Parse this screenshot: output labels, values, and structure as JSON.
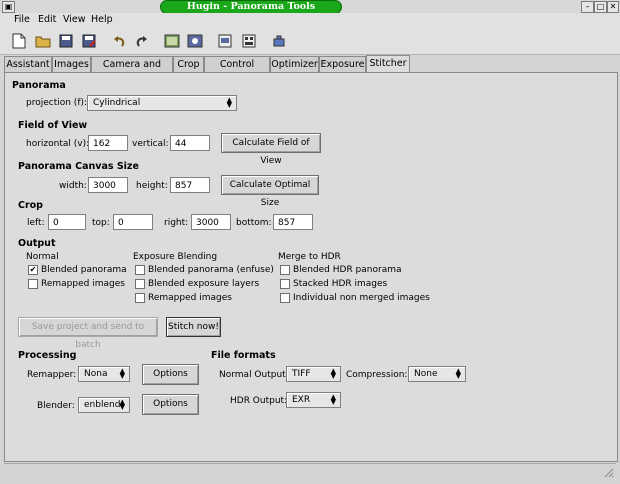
{
  "window": {
    "title": "Hugin - Panorama Tools Frontend"
  },
  "menu": [
    "File",
    "Edit",
    "View",
    "Help"
  ],
  "toolbar_icons": [
    "new-file-icon",
    "open-file-icon",
    "save-icon",
    "save-as-icon",
    "undo-icon",
    "redo-icon",
    "assistant-icon",
    "preview-icon",
    "fast-preview-icon",
    "layout-icon",
    "optimize-icon"
  ],
  "tabs": [
    "Assistant",
    "Images",
    "Camera and Lens",
    "Crop",
    "Control Points",
    "Optimizer",
    "Exposure",
    "Stitcher"
  ],
  "panorama": {
    "heading": "Panorama",
    "projection_label": "projection (f):",
    "projection_value": "Cylindrical"
  },
  "fov": {
    "heading": "Field of View",
    "horizontal_label": "horizontal (v):",
    "horizontal_value": "162",
    "vertical_label": "vertical:",
    "vertical_value": "44",
    "calc_button": "Calculate Field of View"
  },
  "canvas": {
    "heading": "Panorama Canvas Size",
    "width_label": "width:",
    "width_value": "3000",
    "height_label": "height:",
    "height_value": "857",
    "calc_button": "Calculate Optimal Size"
  },
  "crop": {
    "heading": "Crop",
    "left_label": "left:",
    "left_value": "0",
    "top_label": "top:",
    "top_value": "0",
    "right_label": "right:",
    "right_value": "3000",
    "bottom_label": "bottom:",
    "bottom_value": "857"
  },
  "output": {
    "heading": "Output",
    "normal": {
      "heading": "Normal",
      "items": [
        {
          "label": "Blended panorama",
          "checked": true
        },
        {
          "label": "Remapped images",
          "checked": false
        }
      ]
    },
    "exposure": {
      "heading": "Exposure Blending",
      "items": [
        {
          "label": "Blended panorama (enfuse)",
          "checked": false
        },
        {
          "label": "Blended exposure layers",
          "checked": false
        },
        {
          "label": "Remapped images",
          "checked": false
        }
      ]
    },
    "hdr": {
      "heading": "Merge to HDR",
      "items": [
        {
          "label": "Blended HDR panorama",
          "checked": false
        },
        {
          "label": "Stacked HDR images",
          "checked": false
        },
        {
          "label": "Individual non merged images",
          "checked": false
        }
      ]
    }
  },
  "actions": {
    "batch_button": "Save project and send to batch",
    "stitch_button": "Stitch now!"
  },
  "processing": {
    "heading": "Processing",
    "remapper_label": "Remapper:",
    "remapper_value": "Nona",
    "blender_label": "Blender:",
    "blender_value": "enblend",
    "options_label": "Options"
  },
  "file_formats": {
    "heading": "File formats",
    "normal_label": "Normal Output:",
    "normal_value": "TIFF",
    "compression_label": "Compression:",
    "compression_value": "None",
    "hdr_label": "HDR Output:",
    "hdr_value": "EXR"
  }
}
